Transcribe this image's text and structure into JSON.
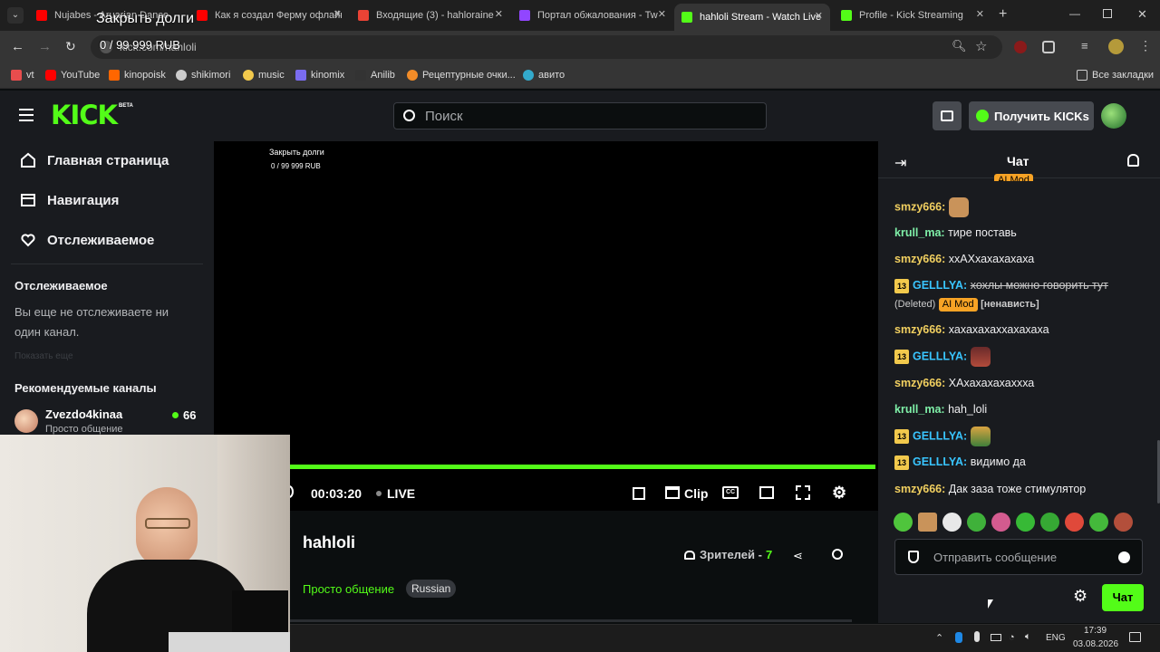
{
  "browser": {
    "tabs": [
      {
        "title": "Nujabes - Aruarian Dance",
        "color": "#ff0000"
      },
      {
        "title": "Как я создал Ферму офлайн",
        "color": "#ff0000"
      },
      {
        "title": "Входящие (3) - hahloraine",
        "color": "#ea4335"
      },
      {
        "title": "Портал обжалования - Tw",
        "color": "#9146ff"
      },
      {
        "title": "hahloli Stream - Watch Live",
        "color": "#53fc18"
      },
      {
        "title": "Profile - Kick Streaming",
        "color": "#53fc18"
      }
    ],
    "url": "kick.com/hahloli",
    "bookmarks": [
      "vt",
      "YouTube",
      "kinopoisk",
      "shikimori",
      "music",
      "kinomix",
      "Anilib",
      "Рецептурные очки...",
      "авито"
    ],
    "all_bookmarks": "Все закладки"
  },
  "overlay": {
    "title": "Закрыть долги",
    "amount": "0 / 99 999 RUB"
  },
  "header": {
    "logo": "KICK",
    "beta": "BETA",
    "search_placeholder": "Поиск",
    "get_kicks": "Получить KICKs"
  },
  "sidebar": {
    "nav": [
      "Главная страница",
      "Навигация",
      "Отслеживаемое"
    ],
    "following_title": "Отслеживаемое",
    "following_empty": "Вы еще не отслеживаете ни один канал.",
    "show_more": "Показать еще",
    "recommended_title": "Рекомендуемые каналы",
    "recommended": [
      {
        "name": "Zvezdo4kinaa",
        "category": "Просто общение",
        "viewers": "66"
      }
    ]
  },
  "player": {
    "time": "00:03:20",
    "live": "LIVE",
    "clip": "Clip"
  },
  "stream": {
    "channel": "hahloli",
    "category": "Просто общение",
    "tag": "Russian",
    "viewers_label": "Зрителей -",
    "viewers": "7"
  },
  "chat": {
    "title": "Чат",
    "messages": [
      {
        "user": "smzy666",
        "color": "#f2d060",
        "text": "",
        "emote": true
      },
      {
        "user": "krull_ma",
        "color": "#7ff0a8",
        "text": "тире поставь"
      },
      {
        "user": "smzy666",
        "color": "#f2d060",
        "text": "ххАХхахахахаха"
      },
      {
        "user": "GELLLYA",
        "color": "#39c5ff",
        "badge": "13",
        "text": "хохлы можно говорить тут",
        "deleted": "(Deleted)",
        "mod": "AI Mod",
        "reason": "[ненависть]"
      },
      {
        "user": "smzy666",
        "color": "#f2d060",
        "text": "хахахахаххахахаха"
      },
      {
        "user": "GELLLYA",
        "color": "#39c5ff",
        "badge": "13",
        "text": "",
        "emote": true
      },
      {
        "user": "smzy666",
        "color": "#f2d060",
        "text": "ХАхахахахаххха"
      },
      {
        "user": "krull_ma",
        "color": "#7ff0a8",
        "text": "hah_loli"
      },
      {
        "user": "GELLLYA",
        "color": "#39c5ff",
        "badge": "13",
        "text": "",
        "emote": true
      },
      {
        "user": "GELLLYA",
        "color": "#39c5ff",
        "badge": "13",
        "text": "видимо да"
      },
      {
        "user": "smzy666",
        "color": "#f2d060",
        "text": "Дак заза тоже стимулятор"
      }
    ],
    "input_placeholder": "Отправить сообщение",
    "send": "Чат"
  },
  "taskbar": {
    "lang": "ENG",
    "time": "17:39",
    "date": "03.08.2026"
  },
  "accent": "#53fc18"
}
